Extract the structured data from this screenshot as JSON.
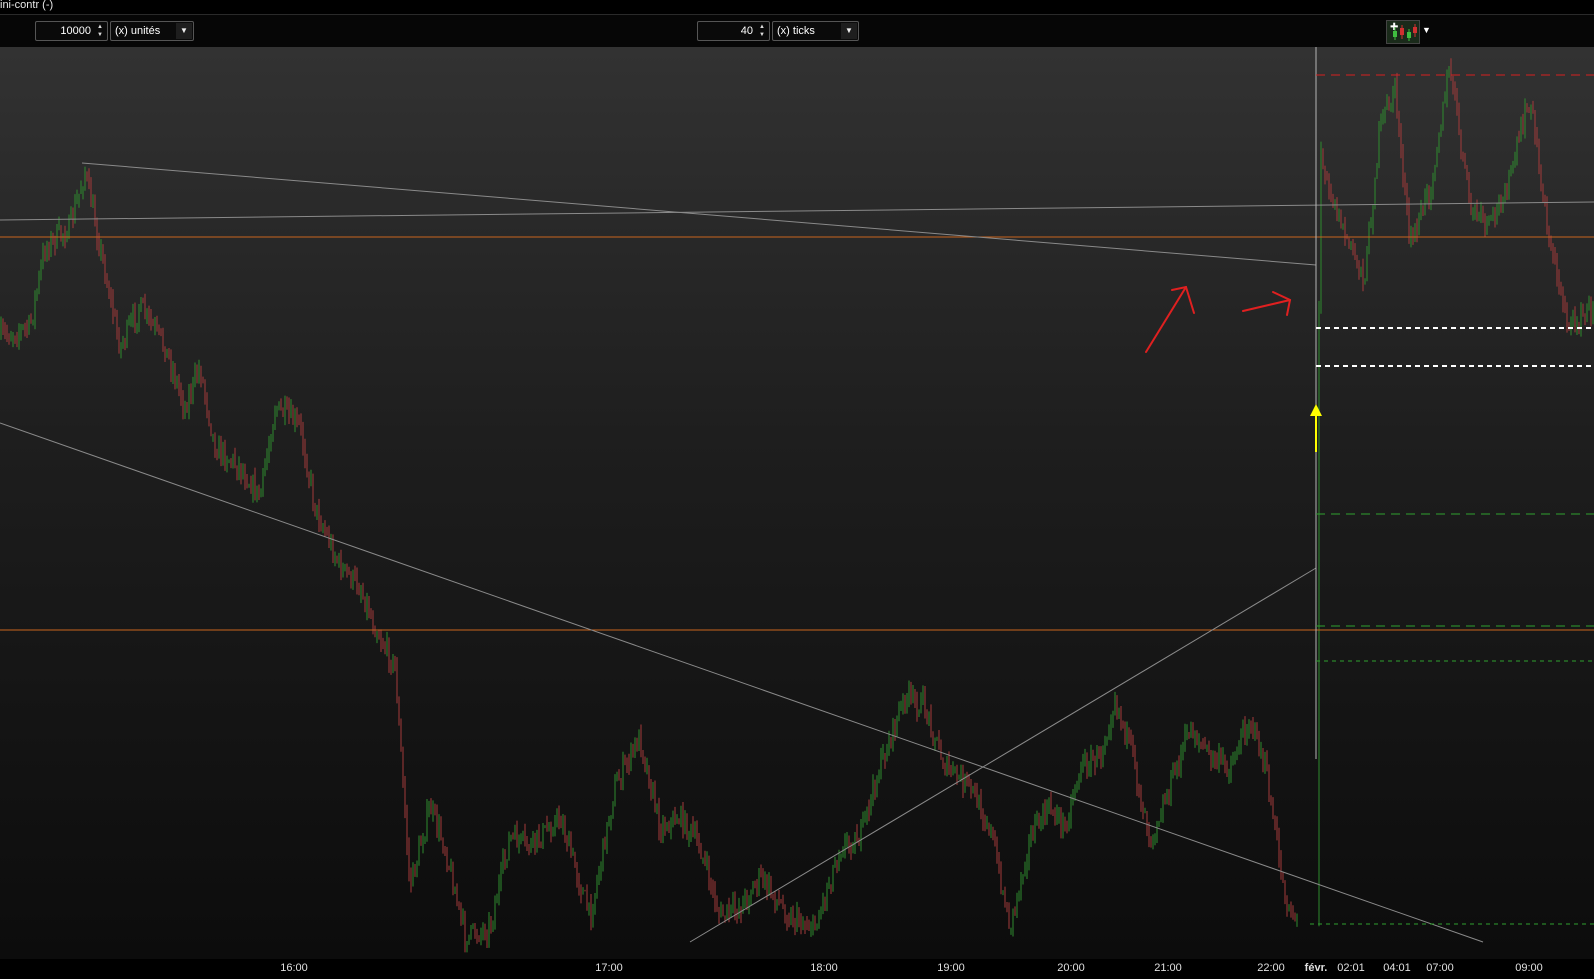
{
  "window": {
    "title": "ini-contr (-)"
  },
  "toolbar": {
    "quantity": {
      "value": "10000",
      "unit_label": "(x) unités"
    },
    "ticks": {
      "value": "40",
      "unit_label": "(x) ticks"
    },
    "chart_type_icon": "candlestick-chart-icon"
  },
  "colors": {
    "background_top": "#323232",
    "background_bottom": "#0c0c0c",
    "candle_up": "#2e8b2e",
    "candle_down": "#a33a3a",
    "trendline": "#8a8a8a",
    "horizontal_level": "#c8641e",
    "stop_level": "#d62020",
    "target_level": "#2fa02f",
    "entry_level": "#ffffff",
    "annotation_arrow": "#e02020",
    "entry_arrow": "#ffff00"
  },
  "time_axis": {
    "labels": [
      "16:00",
      "17:00",
      "18:00",
      "19:00",
      "20:00",
      "21:00",
      "22:00",
      "févr.",
      "02:01",
      "04:01",
      "07:00",
      "09:00"
    ]
  }
}
